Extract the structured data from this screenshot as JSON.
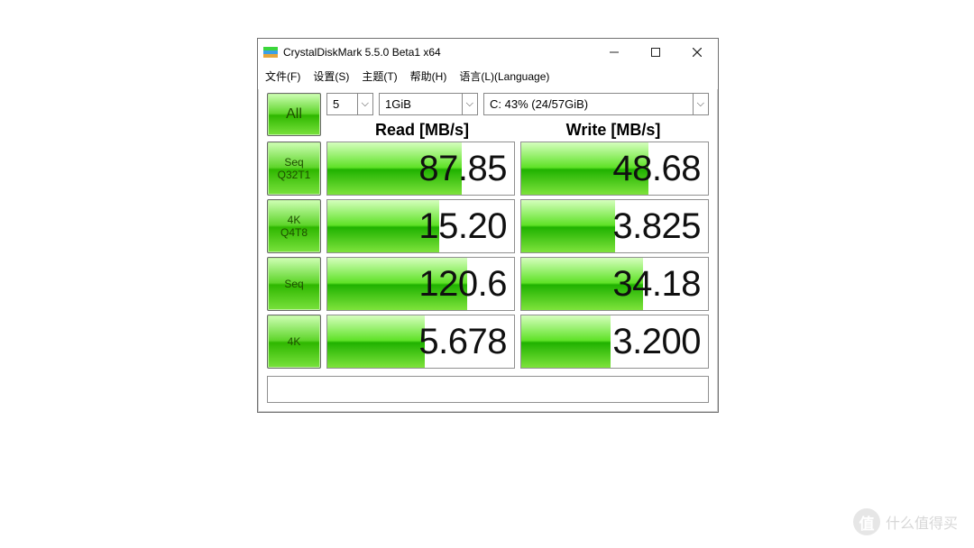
{
  "window": {
    "title": "CrystalDiskMark 5.5.0 Beta1 x64"
  },
  "menus": {
    "file": "文件(F)",
    "settings": "设置(S)",
    "theme": "主题(T)",
    "help": "帮助(H)",
    "language": "语言(L)(Language)"
  },
  "buttons": {
    "all": "All",
    "seq_q32t1_l1": "Seq",
    "seq_q32t1_l2": "Q32T1",
    "k4_q4t8_l1": "4K",
    "k4_q4t8_l2": "Q4T8",
    "seq": "Seq",
    "k4": "4K"
  },
  "selects": {
    "count": "5",
    "size": "1GiB",
    "drive": "C: 43% (24/57GiB)"
  },
  "headers": {
    "read": "Read [MB/s]",
    "write": "Write [MB/s]"
  },
  "results": {
    "seq_q32t1": {
      "read": "87.85",
      "write": "48.68",
      "read_pct": 72,
      "write_pct": 68
    },
    "k4_q4t8": {
      "read": "15.20",
      "write": "3.825",
      "read_pct": 60,
      "write_pct": 50
    },
    "seq": {
      "read": "120.6",
      "write": "34.18",
      "read_pct": 75,
      "write_pct": 65
    },
    "k4": {
      "read": "5.678",
      "write": "3.200",
      "read_pct": 52,
      "write_pct": 48
    }
  },
  "watermark": {
    "icon": "值",
    "text": "什么值得买"
  }
}
